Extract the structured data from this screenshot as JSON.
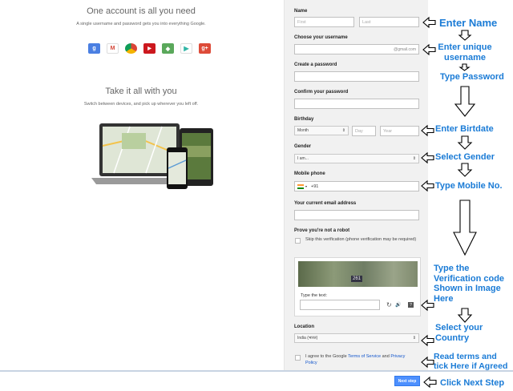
{
  "promo": {
    "title1": "One account is all you need",
    "sub1": "A single username and password gets you into everything Google.",
    "title2": "Take it all with you",
    "sub2": "Switch between devices, and pick up wherever you left off.",
    "icons": [
      {
        "name": "google-search-icon",
        "glyph": "g",
        "color": "#4a7fe2"
      },
      {
        "name": "gmail-icon",
        "glyph": "M",
        "color": "#d44638"
      },
      {
        "name": "chrome-icon",
        "glyph": "●",
        "color": "#e6b521"
      },
      {
        "name": "youtube-icon",
        "glyph": "▶",
        "color": "#cc181e"
      },
      {
        "name": "maps-icon",
        "glyph": "◆",
        "color": "#5aa85b"
      },
      {
        "name": "play-icon",
        "glyph": "▶",
        "color": "#2fb5a5"
      },
      {
        "name": "google-plus-icon",
        "glyph": "g+",
        "color": "#dd4b39"
      }
    ]
  },
  "form": {
    "name_label": "Name",
    "first_placeholder": "First",
    "last_placeholder": "Last",
    "username_label": "Choose your username",
    "username_suffix": "@gmail.com",
    "password_label": "Create a password",
    "confirm_label": "Confirm your password",
    "birthday_label": "Birthday",
    "month_value": "Month",
    "day_placeholder": "Day",
    "year_placeholder": "Year",
    "gender_label": "Gender",
    "gender_value": "I am...",
    "mobile_label": "Mobile phone",
    "mobile_prefix": "+91",
    "email_label": "Your current email address",
    "robot_label": "Prove you're not a robot",
    "skip_verification": "Skip this verification (phone verification may be required)",
    "captcha_code": "261",
    "type_text_label": "Type the text:",
    "location_label": "Location",
    "location_value": "India (भारत)",
    "terms_prefix": "I agree to the Google ",
    "terms_link": "Terms of Service",
    "terms_and": " and ",
    "privacy_link": "Privacy Policy",
    "next_button": "Next step"
  },
  "annotations": {
    "enter_name": "Enter Name",
    "unique_username": "Enter unique username",
    "type_password": "Type Password",
    "enter_birthdate": "Enter Birtdate",
    "select_gender": "Select Gender",
    "type_mobile": "Type Mobile No.",
    "verification": "Type the Verification code Shown in Image Here",
    "select_country": "Select your Country",
    "read_terms": "Read terms and tick Here if Agreed",
    "click_next": "Click Next Step",
    "color": "#1a7bd6"
  }
}
